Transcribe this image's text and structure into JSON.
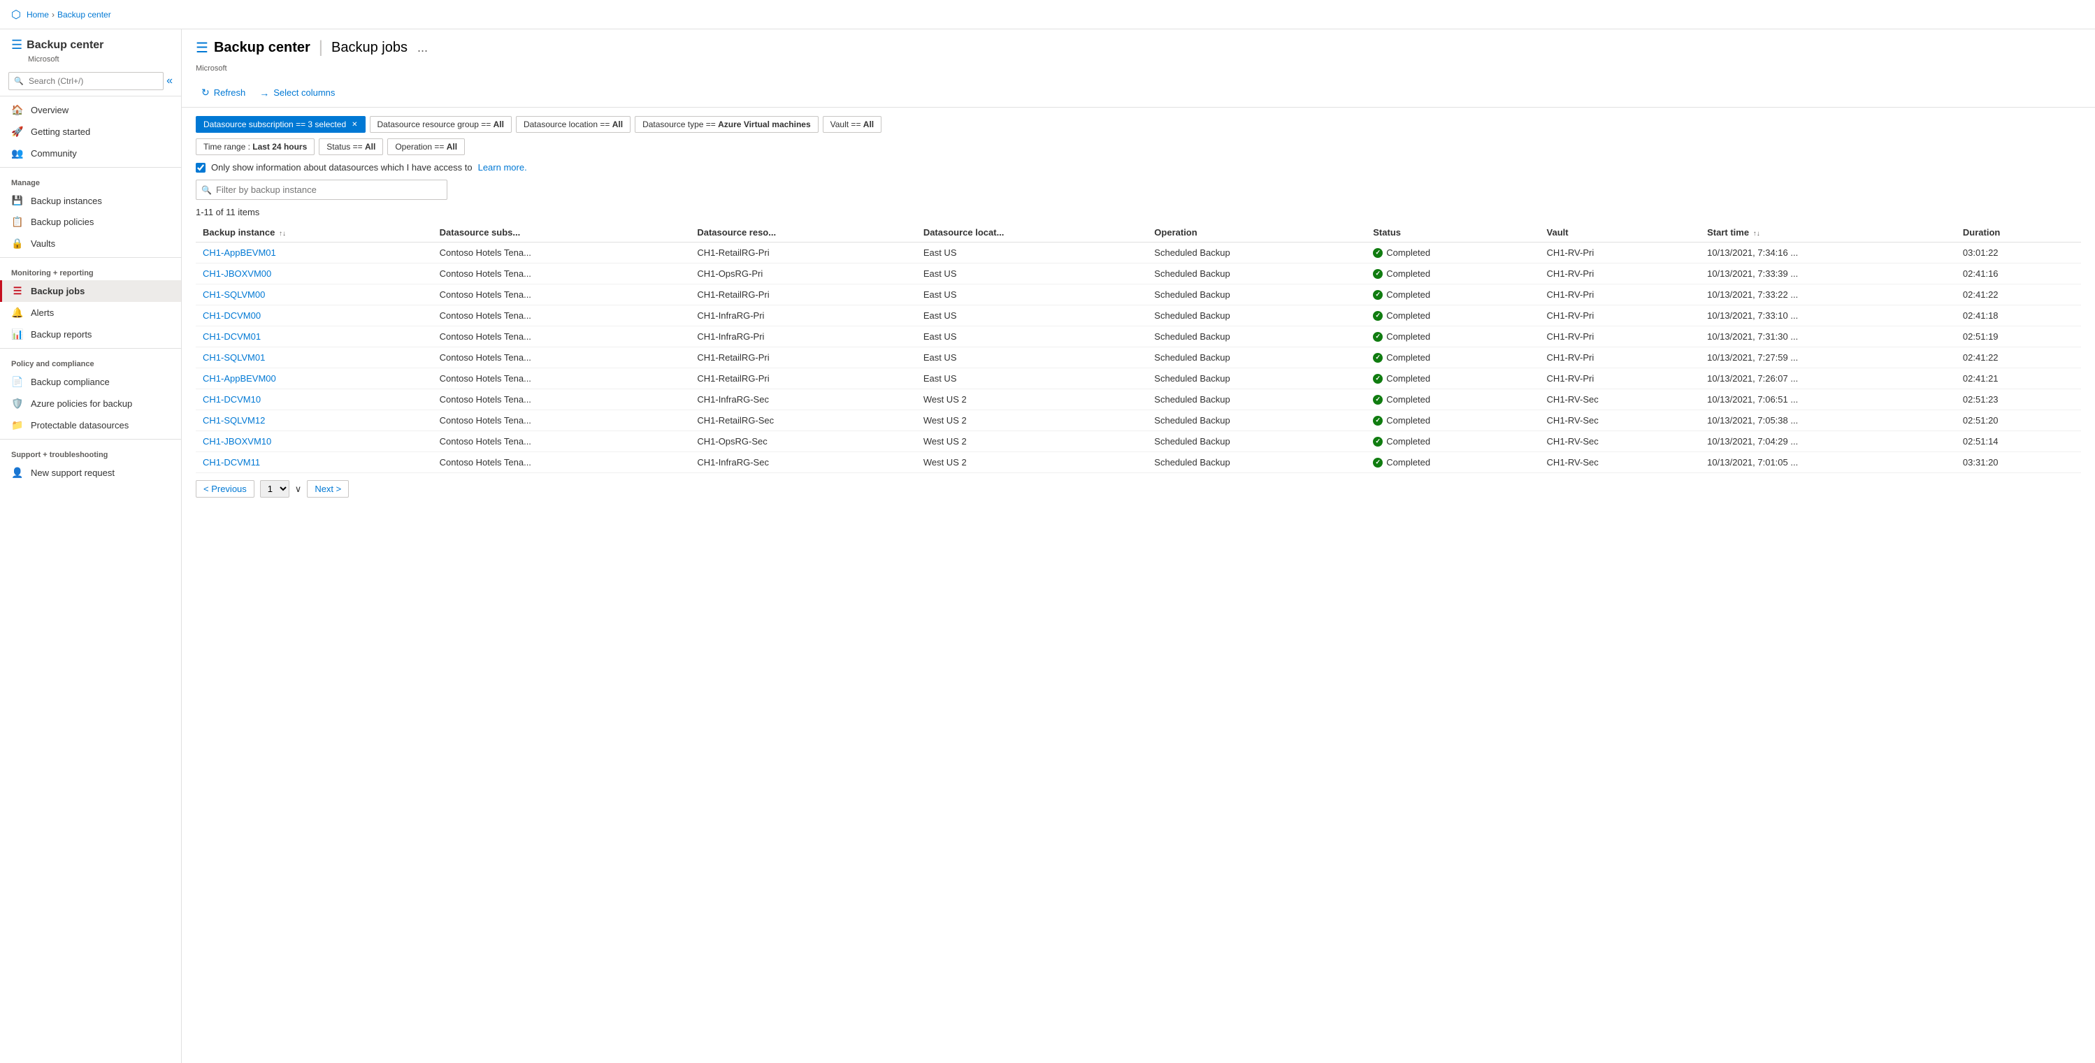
{
  "topbar": {
    "breadcrumbs": [
      "Home",
      "Backup center"
    ]
  },
  "sidebar": {
    "app_name": "Backup center",
    "app_subtitle": "Microsoft",
    "search_placeholder": "Search (Ctrl+/)",
    "collapse_icon": "«",
    "sections": [
      {
        "label": "",
        "items": [
          {
            "id": "overview",
            "label": "Overview",
            "icon": "🏠"
          },
          {
            "id": "getting-started",
            "label": "Getting started",
            "icon": "🚀"
          },
          {
            "id": "community",
            "label": "Community",
            "icon": "👥"
          }
        ]
      },
      {
        "label": "Manage",
        "items": [
          {
            "id": "backup-instances",
            "label": "Backup instances",
            "icon": "💾"
          },
          {
            "id": "backup-policies",
            "label": "Backup policies",
            "icon": "📋"
          },
          {
            "id": "vaults",
            "label": "Vaults",
            "icon": "🔒"
          }
        ]
      },
      {
        "label": "Monitoring + reporting",
        "items": [
          {
            "id": "backup-jobs",
            "label": "Backup jobs",
            "icon": "≡",
            "active": true
          },
          {
            "id": "alerts",
            "label": "Alerts",
            "icon": "🔔"
          },
          {
            "id": "backup-reports",
            "label": "Backup reports",
            "icon": "📊"
          }
        ]
      },
      {
        "label": "Policy and compliance",
        "items": [
          {
            "id": "backup-compliance",
            "label": "Backup compliance",
            "icon": "📄"
          },
          {
            "id": "azure-policies",
            "label": "Azure policies for backup",
            "icon": "🛡️"
          },
          {
            "id": "protectable-datasources",
            "label": "Protectable datasources",
            "icon": "📁"
          }
        ]
      },
      {
        "label": "Support + troubleshooting",
        "items": [
          {
            "id": "new-support-request",
            "label": "New support request",
            "icon": "👤"
          }
        ]
      }
    ]
  },
  "header": {
    "icon": "≡",
    "app": "Backup center",
    "separator": "|",
    "page": "Backup jobs",
    "microsoft": "Microsoft",
    "ellipsis": "..."
  },
  "toolbar": {
    "refresh_label": "Refresh",
    "columns_label": "Select columns"
  },
  "filters": {
    "chips": [
      {
        "label": "Datasource subscription == 3 selected",
        "active": true
      },
      {
        "label": "Datasource resource group == All",
        "active": false
      },
      {
        "label": "Datasource location == All",
        "active": false
      },
      {
        "label": "Datasource type == Azure Virtual machines",
        "active": false
      },
      {
        "label": "Vault == All",
        "active": false
      },
      {
        "label": "Time range : Last 24 hours",
        "active": false
      },
      {
        "label": "Status == All",
        "active": false
      },
      {
        "label": "Operation == All",
        "active": false
      }
    ],
    "checkbox_label": "Only show information about datasources which I have access to",
    "learn_more": "Learn more.",
    "search_placeholder": "Filter by backup instance"
  },
  "table": {
    "items_count": "1-11 of 11 items",
    "columns": [
      {
        "id": "backup-instance",
        "label": "Backup instance",
        "sortable": true
      },
      {
        "id": "datasource-subs",
        "label": "Datasource subs...",
        "sortable": false
      },
      {
        "id": "datasource-reso",
        "label": "Datasource reso...",
        "sortable": false
      },
      {
        "id": "datasource-locat",
        "label": "Datasource locat...",
        "sortable": false
      },
      {
        "id": "operation",
        "label": "Operation",
        "sortable": false
      },
      {
        "id": "status",
        "label": "Status",
        "sortable": false
      },
      {
        "id": "vault",
        "label": "Vault",
        "sortable": false
      },
      {
        "id": "start-time",
        "label": "Start time",
        "sortable": true
      },
      {
        "id": "duration",
        "label": "Duration",
        "sortable": false
      }
    ],
    "rows": [
      {
        "instance": "CH1-AppBEVM01",
        "subs": "Contoso Hotels Tena...",
        "reso": "CH1-RetailRG-Pri",
        "locat": "East US",
        "operation": "Scheduled Backup",
        "status": "Completed",
        "vault": "CH1-RV-Pri",
        "start": "10/13/2021, 7:34:16 ...",
        "duration": "03:01:22"
      },
      {
        "instance": "CH1-JBOXVM00",
        "subs": "Contoso Hotels Tena...",
        "reso": "CH1-OpsRG-Pri",
        "locat": "East US",
        "operation": "Scheduled Backup",
        "status": "Completed",
        "vault": "CH1-RV-Pri",
        "start": "10/13/2021, 7:33:39 ...",
        "duration": "02:41:16"
      },
      {
        "instance": "CH1-SQLVM00",
        "subs": "Contoso Hotels Tena...",
        "reso": "CH1-RetailRG-Pri",
        "locat": "East US",
        "operation": "Scheduled Backup",
        "status": "Completed",
        "vault": "CH1-RV-Pri",
        "start": "10/13/2021, 7:33:22 ...",
        "duration": "02:41:22"
      },
      {
        "instance": "CH1-DCVM00",
        "subs": "Contoso Hotels Tena...",
        "reso": "CH1-InfraRG-Pri",
        "locat": "East US",
        "operation": "Scheduled Backup",
        "status": "Completed",
        "vault": "CH1-RV-Pri",
        "start": "10/13/2021, 7:33:10 ...",
        "duration": "02:41:18"
      },
      {
        "instance": "CH1-DCVM01",
        "subs": "Contoso Hotels Tena...",
        "reso": "CH1-InfraRG-Pri",
        "locat": "East US",
        "operation": "Scheduled Backup",
        "status": "Completed",
        "vault": "CH1-RV-Pri",
        "start": "10/13/2021, 7:31:30 ...",
        "duration": "02:51:19"
      },
      {
        "instance": "CH1-SQLVM01",
        "subs": "Contoso Hotels Tena...",
        "reso": "CH1-RetailRG-Pri",
        "locat": "East US",
        "operation": "Scheduled Backup",
        "status": "Completed",
        "vault": "CH1-RV-Pri",
        "start": "10/13/2021, 7:27:59 ...",
        "duration": "02:41:22"
      },
      {
        "instance": "CH1-AppBEVM00",
        "subs": "Contoso Hotels Tena...",
        "reso": "CH1-RetailRG-Pri",
        "locat": "East US",
        "operation": "Scheduled Backup",
        "status": "Completed",
        "vault": "CH1-RV-Pri",
        "start": "10/13/2021, 7:26:07 ...",
        "duration": "02:41:21"
      },
      {
        "instance": "CH1-DCVM10",
        "subs": "Contoso Hotels Tena...",
        "reso": "CH1-InfraRG-Sec",
        "locat": "West US 2",
        "operation": "Scheduled Backup",
        "status": "Completed",
        "vault": "CH1-RV-Sec",
        "start": "10/13/2021, 7:06:51 ...",
        "duration": "02:51:23"
      },
      {
        "instance": "CH1-SQLVM12",
        "subs": "Contoso Hotels Tena...",
        "reso": "CH1-RetailRG-Sec",
        "locat": "West US 2",
        "operation": "Scheduled Backup",
        "status": "Completed",
        "vault": "CH1-RV-Sec",
        "start": "10/13/2021, 7:05:38 ...",
        "duration": "02:51:20"
      },
      {
        "instance": "CH1-JBOXVM10",
        "subs": "Contoso Hotels Tena...",
        "reso": "CH1-OpsRG-Sec",
        "locat": "West US 2",
        "operation": "Scheduled Backup",
        "status": "Completed",
        "vault": "CH1-RV-Sec",
        "start": "10/13/2021, 7:04:29 ...",
        "duration": "02:51:14"
      },
      {
        "instance": "CH1-DCVM11",
        "subs": "Contoso Hotels Tena...",
        "reso": "CH1-InfraRG-Sec",
        "locat": "West US 2",
        "operation": "Scheduled Backup",
        "status": "Completed",
        "vault": "CH1-RV-Sec",
        "start": "10/13/2021, 7:01:05 ...",
        "duration": "03:31:20"
      }
    ]
  },
  "pagination": {
    "prev_label": "< Previous",
    "next_label": "Next >",
    "page_value": "1",
    "page_options": [
      "1"
    ]
  }
}
